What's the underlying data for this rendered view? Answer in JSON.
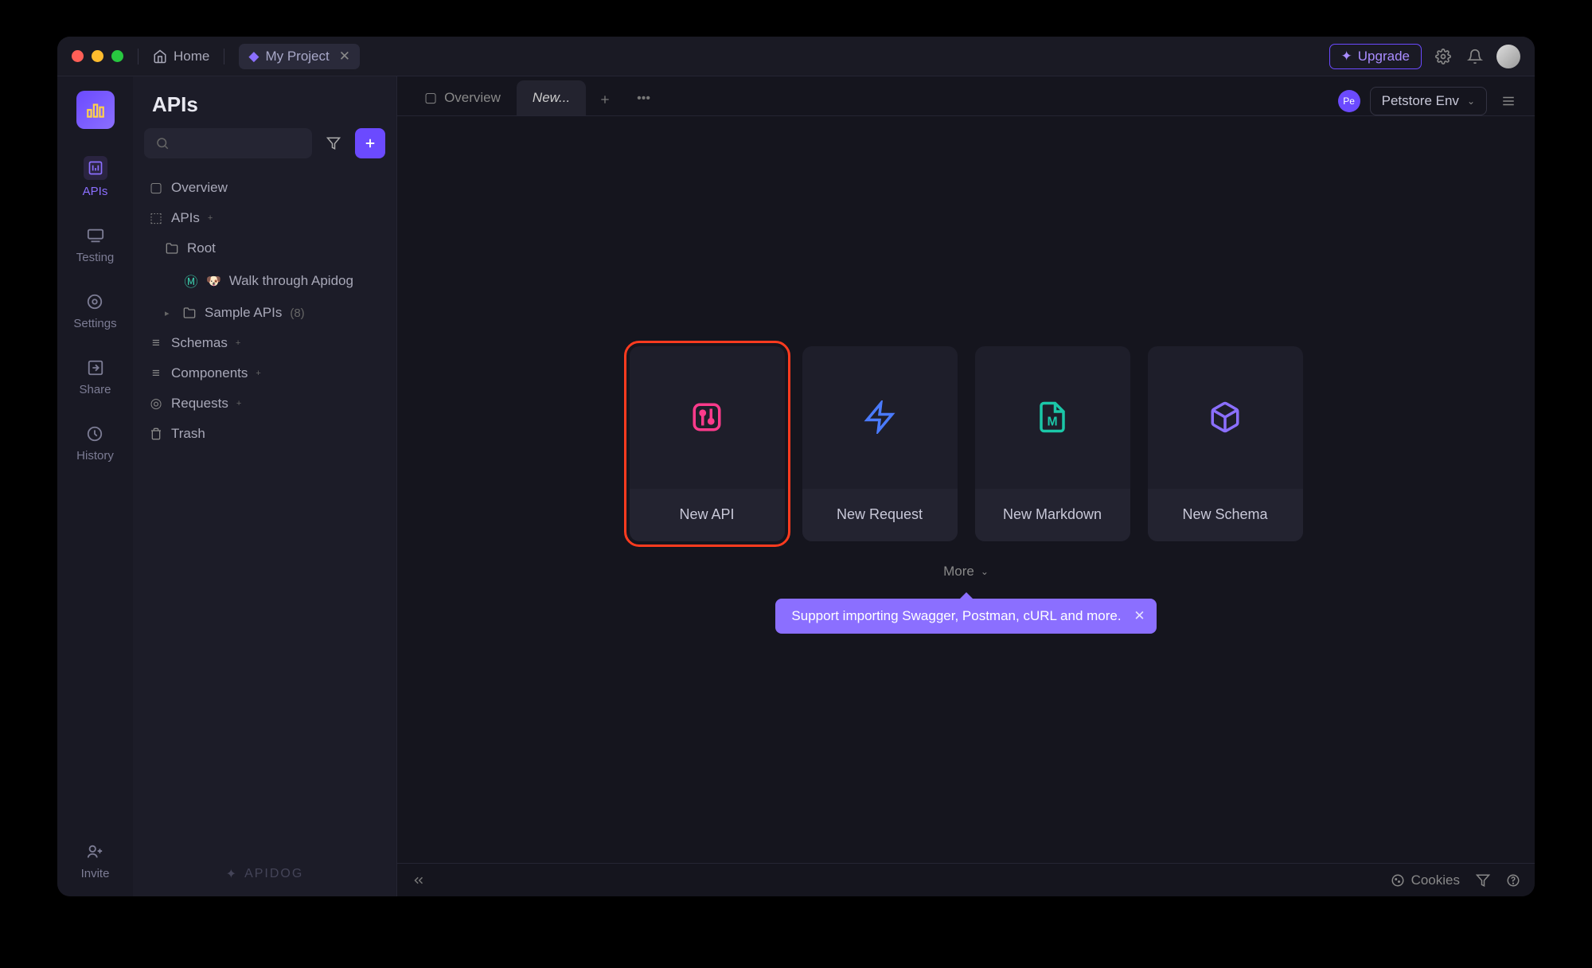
{
  "titlebar": {
    "home": "Home",
    "project": "My Project",
    "upgrade": "Upgrade"
  },
  "rail": {
    "items": [
      "APIs",
      "Testing",
      "Settings",
      "Share",
      "History"
    ],
    "invite": "Invite"
  },
  "sidebar": {
    "title": "APIs",
    "tree": {
      "overview": "Overview",
      "apis": "APIs",
      "root": "Root",
      "walk": "Walk through Apidog",
      "sample": "Sample APIs",
      "sample_count": "(8)",
      "schemas": "Schemas",
      "components": "Components",
      "requests": "Requests",
      "trash": "Trash"
    },
    "brand": "APIDOG"
  },
  "tabs": {
    "overview": "Overview",
    "new": "New..."
  },
  "env": {
    "badge": "Pe",
    "name": "Petstore Env"
  },
  "cards": {
    "api": "New API",
    "request": "New Request",
    "markdown": "New Markdown",
    "schema": "New Schema",
    "more": "More"
  },
  "tip": "Support importing Swagger, Postman, cURL and more.",
  "status": {
    "cookies": "Cookies"
  }
}
